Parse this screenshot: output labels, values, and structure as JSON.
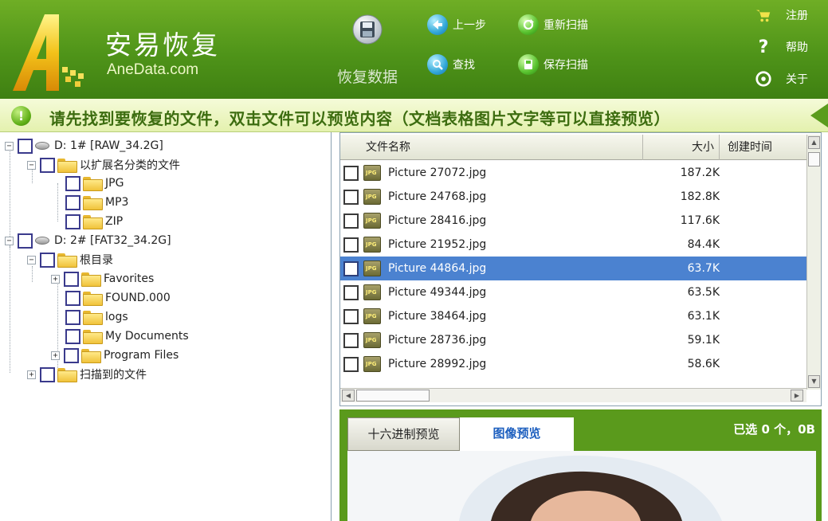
{
  "app": {
    "name_cn": "安易恢复",
    "name_en": "AneData.com"
  },
  "toolbar": {
    "recover_label": "恢复数据",
    "prev_label": "上一步",
    "rescan_label": "重新扫描",
    "find_label": "查找",
    "save_scan_label": "保存扫描"
  },
  "right_menu": {
    "register_label": "注册",
    "help_label": "帮助",
    "about_label": "关于"
  },
  "notice": {
    "message": "请先找到要恢复的文件，双击文件可以预览内容（文档表格图片文字等可以直接预览）"
  },
  "tree": {
    "nodes": [
      {
        "label": "D:  1# [RAW_34.2G]"
      },
      {
        "label": "以扩展名分类的文件"
      },
      {
        "label": "JPG"
      },
      {
        "label": "MP3"
      },
      {
        "label": "ZIP"
      },
      {
        "label": "D:  2# [FAT32_34.2G]"
      },
      {
        "label": "根目录"
      },
      {
        "label": "Favorites"
      },
      {
        "label": "FOUND.000"
      },
      {
        "label": "logs"
      },
      {
        "label": "My Documents"
      },
      {
        "label": "Program Files"
      },
      {
        "label": "扫描到的文件"
      }
    ]
  },
  "file_list": {
    "columns": [
      "文件名称",
      "大小",
      "创建时间"
    ],
    "rows": [
      {
        "name": "Picture 27072.jpg",
        "size": "187.2K"
      },
      {
        "name": "Picture 24768.jpg",
        "size": "182.8K"
      },
      {
        "name": "Picture 28416.jpg",
        "size": "117.6K"
      },
      {
        "name": "Picture 21952.jpg",
        "size": "84.4K"
      },
      {
        "name": "Picture 44864.jpg",
        "size": "63.7K"
      },
      {
        "name": "Picture 49344.jpg",
        "size": "63.5K"
      },
      {
        "name": "Picture 38464.jpg",
        "size": "63.1K"
      },
      {
        "name": "Picture 28736.jpg",
        "size": "59.1K"
      },
      {
        "name": "Picture 28992.jpg",
        "size": "58.6K"
      }
    ],
    "selected_index": 4
  },
  "preview": {
    "tab_hex": "十六进制预览",
    "tab_image": "图像预览",
    "status": "已选 0 个，0B"
  },
  "colors": {
    "header_green": "#4f9419",
    "selection_blue": "#4b82d0",
    "notice_text": "#3d6d10"
  }
}
